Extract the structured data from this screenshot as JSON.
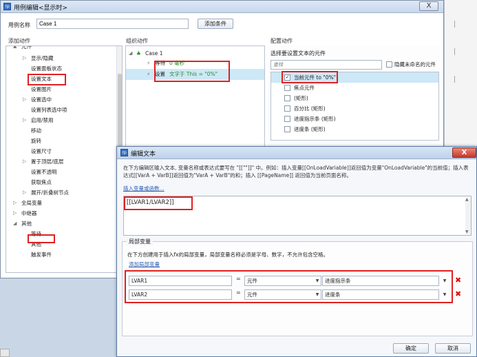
{
  "main_dialog": {
    "title": "用例编辑<显示时>",
    "close_label": "X",
    "case_name_label": "用例名称",
    "case_name_value": "Case 1",
    "add_condition_label": "添加条件"
  },
  "add_actions": {
    "header": "添加动作",
    "items": [
      {
        "label": "元件",
        "arrow": "▲"
      },
      {
        "label": "显示/隐藏",
        "arrow": "▷"
      },
      {
        "label": "设置面板状态",
        "arrow": ""
      },
      {
        "label": "设置文本",
        "arrow": ""
      },
      {
        "label": "设置图片",
        "arrow": ""
      },
      {
        "label": "设置选中",
        "arrow": "▷"
      },
      {
        "label": "设置列表选中项",
        "arrow": ""
      },
      {
        "label": "启用/禁用",
        "arrow": "▷"
      },
      {
        "label": "移动",
        "arrow": ""
      },
      {
        "label": "旋转",
        "arrow": ""
      },
      {
        "label": "设置尺寸",
        "arrow": ""
      },
      {
        "label": "置于顶层/底层",
        "arrow": "▷"
      },
      {
        "label": "设置不透明",
        "arrow": ""
      },
      {
        "label": "获取焦点",
        "arrow": ""
      },
      {
        "label": "展开/折叠树节点",
        "arrow": "▷"
      },
      {
        "label": "全局变量",
        "arrow": "▷"
      },
      {
        "label": "中继器",
        "arrow": "▷"
      },
      {
        "label": "其他",
        "arrow": "◢"
      },
      {
        "label": "等待",
        "arrow": ""
      },
      {
        "label": "其他",
        "arrow": ""
      },
      {
        "label": "触发事件",
        "arrow": ""
      }
    ]
  },
  "organize_actions": {
    "header": "组织动作",
    "case_label": "Case 1",
    "wait_label": "等待",
    "wait_detail": "0 毫秒",
    "settext_label": "设置",
    "settext_detail": "文字于 This = \"0%\""
  },
  "configure_actions": {
    "header": "配置动作",
    "sub_header": "选择要设置文本的元件",
    "filter_placeholder": "查找",
    "hide_unnamed_label": "隐藏未命名的元件",
    "items": [
      {
        "label": "当前元件 to \"0%\"",
        "checked": true
      },
      {
        "label": "焦点元件",
        "checked": false
      },
      {
        "label": "(矩形)",
        "checked": false
      },
      {
        "label": "百分比 (矩形)",
        "checked": false
      },
      {
        "label": "进度指示条 (矩形)",
        "checked": false
      },
      {
        "label": "进度条 (矩形)",
        "checked": false
      }
    ]
  },
  "edit_text_dialog": {
    "title": "编辑文本",
    "close_label": "X",
    "description": "在下方编辑区输入文本, 变量名称或表达式要写在 \"[[\"\"]]\" 中。例如：插入变量[[OnLoadVariable]]返回值为变量\"OnLoadVariable\"的当前值；插入表达式[[VarA + VarB]]返回值为\"VarA + VarB\"的和；插入 [[PageName]] 返回值为当前页面名称。",
    "insert_link": "插入变量或函数...",
    "expression": "[[LVAR1/LVAR2]]",
    "local_vars_legend": "局部变量",
    "local_vars_desc": "在下方创建用于插入fx的局部变量，局部变量名称必须是字母、数字，不允许包含空格。",
    "add_local_var_link": "添加局部变量",
    "variables": [
      {
        "name": "LVAR1",
        "equals": "=",
        "type": "元件",
        "target": "进度指示条"
      },
      {
        "name": "LVAR2",
        "equals": "=",
        "type": "元件",
        "target": "进度条"
      }
    ],
    "delete_label": "✖",
    "ok_label": "确定",
    "cancel_label": "取消"
  }
}
